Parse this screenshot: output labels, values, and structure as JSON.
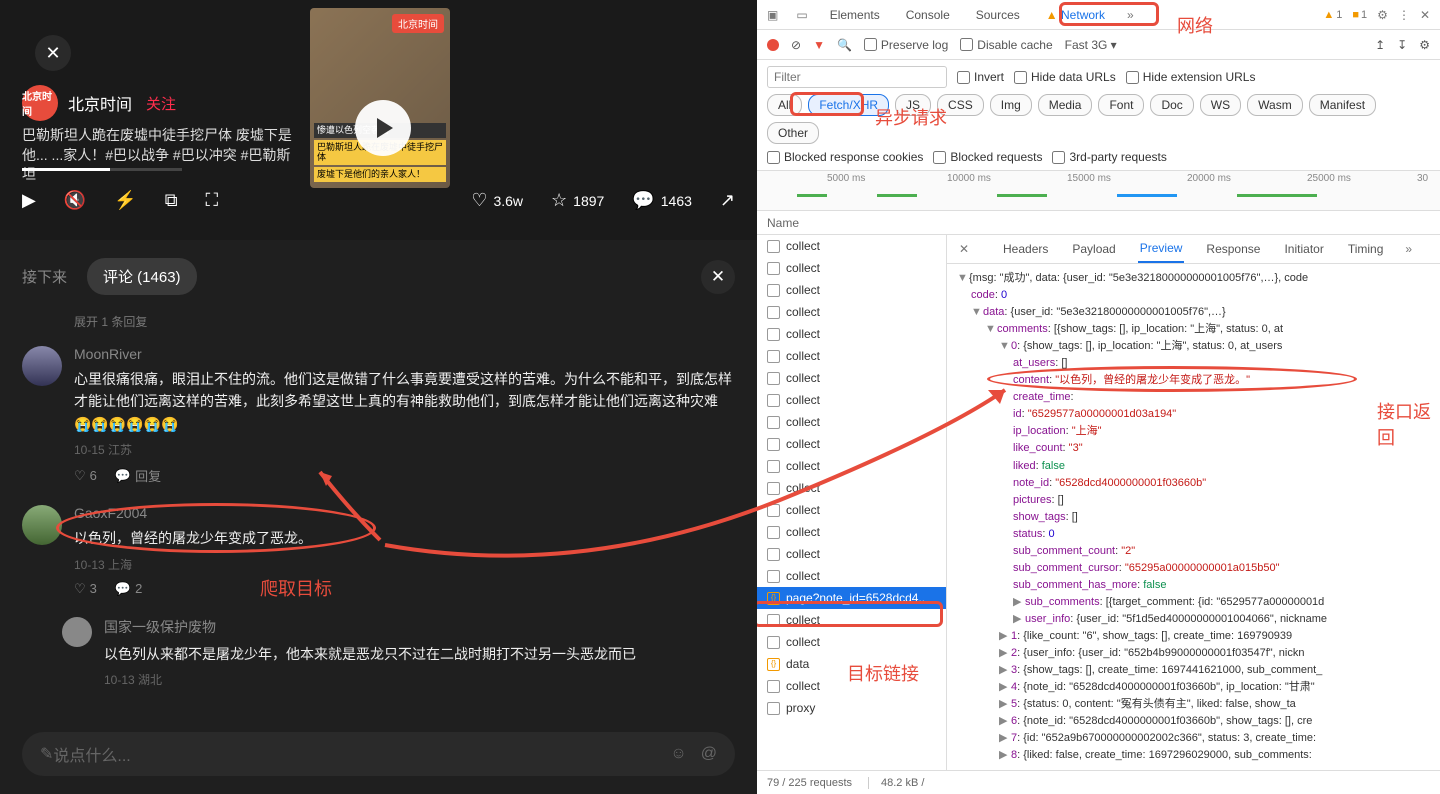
{
  "video": {
    "close": "✕",
    "badge": "北京时间",
    "author": "北京时间",
    "follow": "关注",
    "title": "巴勒斯坦人跪在废墟中徒手挖尸体 废墟下是他... ...家人！#巴以战争 #巴以冲突 #巴勒斯坦",
    "caption_line1": "惨遭以色列空袭后",
    "caption_line2": "巴勒斯坦人跪在废墟中徒手挖尸体",
    "caption_line3": "废墟下是他们的亲人家人！",
    "likes": "3.6w",
    "favs": "1897",
    "comments_count": "1463"
  },
  "section": {
    "next_label": "接下来",
    "comments_tab": "评论 (1463)",
    "expand_hint": "展开 1 条回复"
  },
  "comments": [
    {
      "name": "MoonRiver",
      "text": "心里很痛很痛，眼泪止不住的流。他们这是做错了什么事竟要遭受这样的苦难。为什么不能和平，到底怎样才能让他们远离这样的苦难，此刻多希望这世上真的有神能救助他们，到底怎样才能让他们远离这种灾难😭😭😭😭😭😭",
      "meta": "10-15 江苏",
      "likes": "6",
      "replies": "回复"
    },
    {
      "name": "GaoxF2004",
      "text": "以色列，曾经的屠龙少年变成了恶龙。",
      "meta": "10-13 上海",
      "likes": "3",
      "replies": "2"
    },
    {
      "name": "国家一级保护废物",
      "text": "以色列从来都不是屠龙少年，他本来就是恶龙只不过在二战时期打不过另一头恶龙而已",
      "meta": "10-13 湖北",
      "likes": "",
      "replies": ""
    }
  ],
  "reply": {
    "placeholder": "说点什么..."
  },
  "devtools": {
    "tabs": [
      "Elements",
      "Console",
      "Sources",
      "Network"
    ],
    "warn_count": "1",
    "issue_count": "1",
    "preserve_log": "Preserve log",
    "disable_cache": "Disable cache",
    "throttle": "Fast 3G",
    "filter_placeholder": "Filter",
    "invert": "Invert",
    "hide_data": "Hide data URLs",
    "hide_ext": "Hide extension URLs",
    "filter_chips": [
      "All",
      "Fetch/XHR",
      "JS",
      "CSS",
      "Img",
      "Media",
      "Font",
      "Doc",
      "WS",
      "Wasm",
      "Manifest",
      "Other"
    ],
    "block_cookies": "Blocked response cookies",
    "block_req": "Blocked requests",
    "third_party": "3rd-party requests",
    "ticks": [
      "5000 ms",
      "10000 ms",
      "15000 ms",
      "20000 ms",
      "25000 ms",
      "30"
    ],
    "name_col": "Name",
    "requests": [
      "collect",
      "collect",
      "collect",
      "collect",
      "collect",
      "collect",
      "collect",
      "collect",
      "collect",
      "collect",
      "collect",
      "collect",
      "collect",
      "collect",
      "collect",
      "collect",
      "page?note_id=6528dcd4..",
      "collect",
      "collect",
      "data",
      "collect",
      "proxy"
    ],
    "selected_idx": 16,
    "pv_tabs": [
      "Headers",
      "Payload",
      "Preview",
      "Response",
      "Initiator",
      "Timing"
    ],
    "status": {
      "requests": "79 / 225 requests",
      "size": "48.2 kB /"
    }
  },
  "json": {
    "root_summary": "{msg: \"成功\", data: {user_id: \"5e3e32180000000001005f76\",…}, code",
    "code": "0",
    "data_summary": "{user_id: \"5e3e32180000000001005f76\",…}",
    "comments_summary": "[{show_tags: [], ip_location: \"上海\", status: 0, at",
    "item0_summary": "{show_tags: [], ip_location: \"上海\", status: 0, at_users",
    "at_users": "[]",
    "content": "\"以色列，曾经的屠龙少年变成了恶龙。\"",
    "create_time": "",
    "id": "\"6529577a00000001d03a194\"",
    "ip_location": "\"上海\"",
    "like_count": "\"3\"",
    "liked": "false",
    "note_id": "\"6528dcd4000000001f03660b\"",
    "pictures": "[]",
    "show_tags": "[]",
    "status": "0",
    "sub_comment_count": "\"2\"",
    "sub_comment_cursor": "\"65295a00000000001a015b50\"",
    "sub_comment_has_more": "false",
    "sub_comments": "[{target_comment: {id: \"6529577a00000001d",
    "user_info": "{user_id: \"5f1d5ed40000000001004066\", nickname",
    "rest": [
      "1: {like_count: \"6\", show_tags: [], create_time: 169790939",
      "2: {user_info: {user_id: \"652b4b99000000001f03547f\", nickn",
      "3: {show_tags: [], create_time: 1697441621000, sub_comment_",
      "4: {note_id: \"6528dcd4000000001f03660b\", ip_location: \"甘肃\"",
      "5: {status: 0, content: \"冤有头债有主\", liked: false, show_ta",
      "6: {note_id: \"6528dcd4000000001f03660b\", show_tags: [], cre",
      "7: {id: \"652a9b670000000002002c366\", status: 3, create_time:",
      "8: {liked: false, create_time: 1697296029000, sub_comments:"
    ]
  },
  "anno": {
    "network": "网络",
    "async": "异步请求",
    "target": "爬取目标",
    "link": "目标链接",
    "resp": "接口返回"
  }
}
